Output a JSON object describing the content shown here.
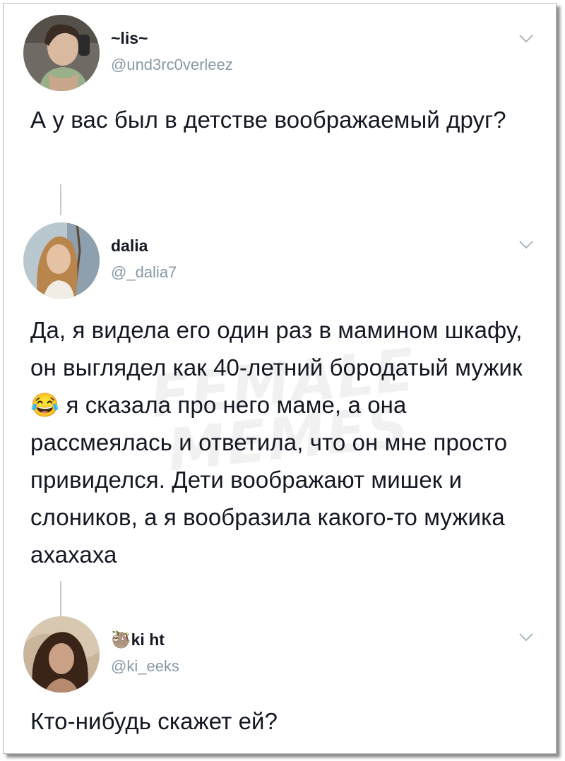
{
  "watermark": {
    "line1": "FEMALE",
    "line2": "MEMES"
  },
  "tweets": [
    {
      "display_name": "~lis~",
      "handle": "@und3rc0verleez",
      "text": "А у вас был в детстве воображаемый друг?",
      "avatar_icon": "profile-photo-woman-car"
    },
    {
      "display_name": "dalia",
      "handle": "@_dalia7",
      "text": "Да, я видела его один раз в мамином шкафу, он выглядел как 40-летний бородатый мужик 😂 я сказала про него маме, а она рассмеялась и ответила, что он мне просто привиделся. Дети воображают мишек и слоников, а я вообразила какого-то мужика ахахаха",
      "avatar_icon": "profile-photo-woman-curly"
    },
    {
      "display_name": "🦥ki ht",
      "handle": "@ki_eeks",
      "text": "Кто-нибудь скажет ей?",
      "avatar_icon": "profile-photo-woman-dark-hair"
    }
  ],
  "icons": {
    "more": "chevron-down-icon",
    "thread": "thread-connector-line"
  },
  "colors": {
    "text": "#141823",
    "handle": "#8899a6",
    "thread_line": "#c4ccd3",
    "chevron": "#aab8c2"
  }
}
